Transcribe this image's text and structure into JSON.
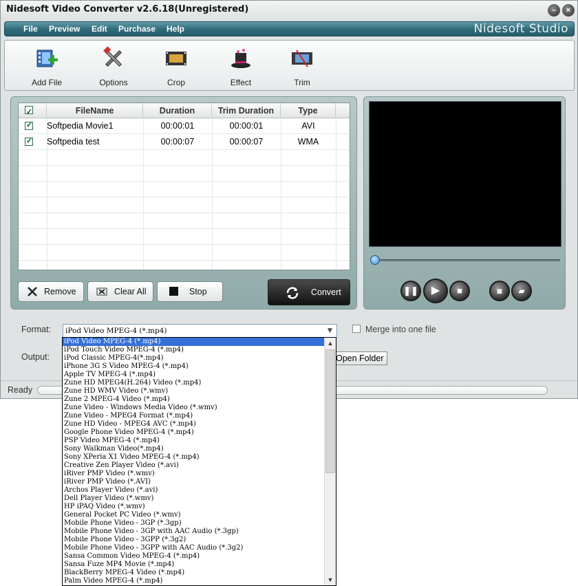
{
  "window": {
    "title": "Nidesoft Video Converter v2.6.18(Unregistered)"
  },
  "menu": {
    "items": [
      "File",
      "Preview",
      "Edit",
      "Purchase",
      "Help"
    ],
    "brand": "Nidesoft Studio"
  },
  "toolbar": {
    "add_file": "Add File",
    "options": "Options",
    "crop": "Crop",
    "effect": "Effect",
    "trim": "Trim"
  },
  "file_list": {
    "columns": [
      "FileName",
      "Duration",
      "Trim Duration",
      "Type"
    ],
    "rows": [
      {
        "name": "Softpedia Movie1",
        "duration": "00:00:01",
        "trim_duration": "00:00:01",
        "type": "AVI"
      },
      {
        "name": "Softpedia test",
        "duration": "00:00:07",
        "trim_duration": "00:00:07",
        "type": "WMA"
      }
    ]
  },
  "buttons": {
    "remove": "Remove",
    "clear_all": "Clear All",
    "stop": "Stop",
    "convert": "Convert",
    "open_folder": "Open Folder"
  },
  "settings": {
    "format_label": "Format:",
    "output_label": "Output:",
    "format_value": "iPod Video MPEG-4 (*.mp4)",
    "merge_label": "Merge into one file"
  },
  "status": {
    "text": "Ready"
  },
  "format_options": [
    "iPod Video MPEG-4 (*.mp4)",
    "iPod Touch Video MPEG-4 (*.mp4)",
    "iPod Classic MPEG-4(*.mp4)",
    "iPhone 3G S Video MPEG-4 (*.mp4)",
    "Apple TV MPEG-4  (*.mp4)",
    "Zune HD MPEG4(H.264) Video (*.mp4)",
    "Zune HD WMV Video (*.wmv)",
    "Zune 2 MPEG-4 Video (*.mp4)",
    "Zune Video - Windows Media Video (*.wmv)",
    "Zune Video - MPEG4 Format (*.mp4)",
    "Zune HD Video - MPEG4 AVC (*.mp4)",
    "Google Phone Video MPEG-4 (*.mp4)",
    "PSP Video MPEG-4 (*.mp4)",
    "Sony Walkman Video(*.mp4)",
    "Sony XPeria X1 Video MPEG-4 (*.mp4)",
    "Creative Zen Player Video (*.avi)",
    "iRiver PMP Video (*.wmv)",
    "iRiver PMP Video (*.AVI)",
    "Archos Player Video (*.avi)",
    "Dell Player Video (*.wmv)",
    "HP iPAQ Video (*.wmv)",
    "General Pocket PC Video (*.wmv)",
    "Mobile Phone Video - 3GP (*.3gp)",
    "Mobile Phone Video - 3GP with AAC Audio (*.3gp)",
    "Mobile Phone Video - 3GPP (*.3g2)",
    "Mobile Phone Video - 3GPP with AAC Audio (*.3g2)",
    "Sansa Common Video MPEG-4 (*.mp4)",
    "Sansa Fuze MP4 Movie (*.mp4)",
    "BlackBerry MPEG-4 Video (*.mp4)",
    "Palm Video MPEG-4 (*.mp4)"
  ],
  "selected_index": 0
}
